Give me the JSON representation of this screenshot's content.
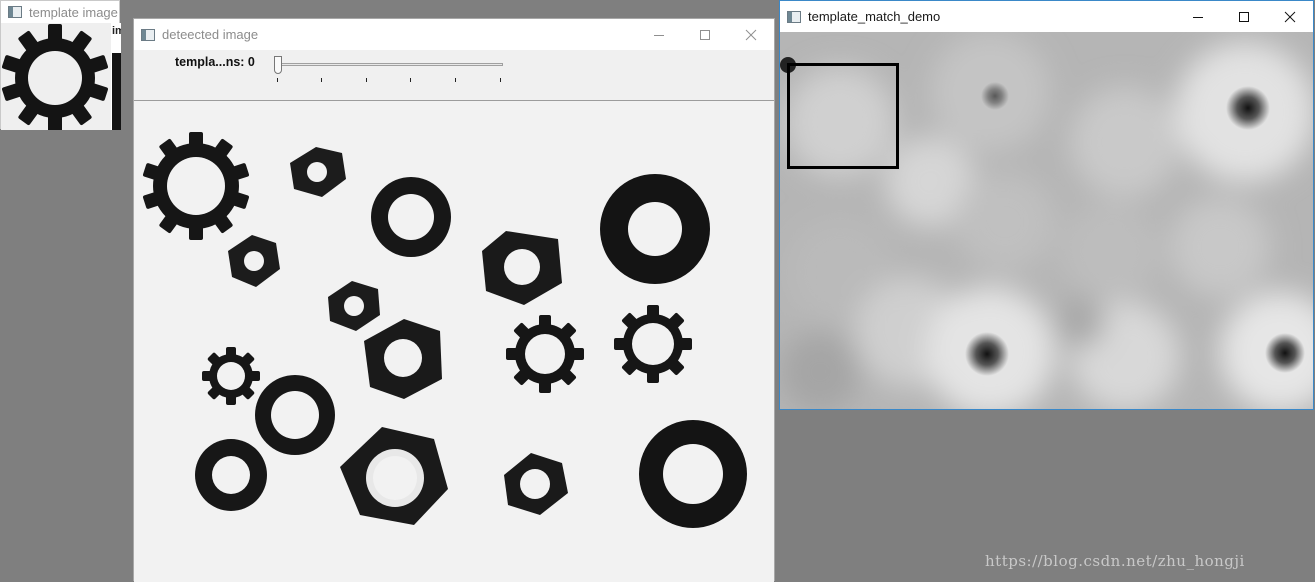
{
  "windows": {
    "template": {
      "title": "template image",
      "icon": "opencv-window-icon",
      "partial_label": "im"
    },
    "detected": {
      "title": "deteected image",
      "icon": "opencv-window-icon",
      "trackbar": {
        "label": "templa...ns: 0",
        "value": 0,
        "min": 0,
        "max": 5
      }
    },
    "demo": {
      "title": "template_match_demo",
      "icon": "opencv-window-icon",
      "match_box": "match-rectangle"
    }
  },
  "controls": {
    "minimize": "—",
    "maximize": "☐",
    "close": "✕"
  },
  "watermark": "https://blog.csdn.net/zhu_hongji",
  "colors": {
    "desktop": "#7f7f7f",
    "active_border": "#3a88c8",
    "inactive_title": "#8c8c8c"
  }
}
